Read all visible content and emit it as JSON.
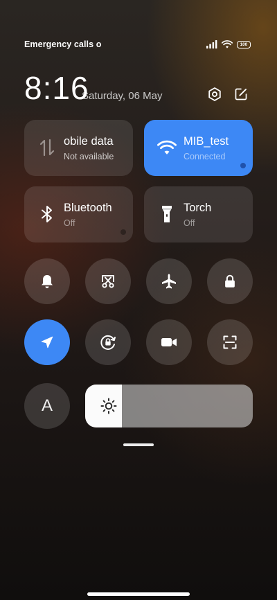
{
  "status_bar": {
    "carrier": "Emergency calls o",
    "battery_level": "100"
  },
  "header": {
    "time": "8:16",
    "date": "Saturday, 06 May"
  },
  "tiles": [
    {
      "label": "obile data",
      "status": "Not available",
      "icon": "mobile-data-icon",
      "active": false
    },
    {
      "label": "MIB_test",
      "status": "Connected",
      "icon": "wifi-icon",
      "active": true
    },
    {
      "label": "Bluetooth",
      "status": "Off",
      "icon": "bluetooth-icon",
      "active": false
    },
    {
      "label": "Torch",
      "status": "Off",
      "icon": "torch-icon",
      "active": false
    }
  ],
  "toggles_row1": [
    {
      "icon": "bell-icon",
      "active": false
    },
    {
      "icon": "screenshot-icon",
      "active": false
    },
    {
      "icon": "airplane-icon",
      "active": false
    },
    {
      "icon": "lock-icon",
      "active": false
    }
  ],
  "toggles_row2": [
    {
      "icon": "location-icon",
      "active": true
    },
    {
      "icon": "rotation-lock-icon",
      "active": false
    },
    {
      "icon": "screen-record-icon",
      "active": false
    },
    {
      "icon": "scanner-icon",
      "active": false
    }
  ],
  "font_button": {
    "label": "A"
  },
  "brightness": {
    "level": 0.22,
    "icon": "sun-icon"
  },
  "colors": {
    "accent": "#3d88f5",
    "tile": "rgba(255,255,255,0.11)",
    "round": "rgba(255,255,255,0.14)"
  }
}
